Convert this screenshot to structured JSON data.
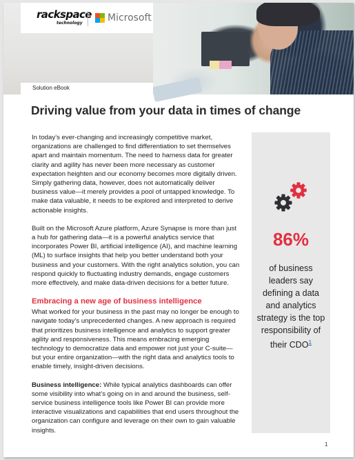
{
  "header": {
    "logo_primary": "rackspace",
    "logo_primary_sub": "technology",
    "logo_partner": "Microsoft",
    "microsoft_colors": [
      "#f25022",
      "#7fba00",
      "#00a4ef",
      "#ffb900"
    ],
    "doc_type": "Solution eBook"
  },
  "title": "Driving value from your data in times of change",
  "body": {
    "paragraphs": [
      "In today’s ever-changing and increasingly competitive market, organizations are challenged to find differentiation to set themselves apart and maintain momentum. The need to harness data for greater clarity and agility has never been more necessary as customer expectation heighten and our economy becomes more digitally driven. Simply gathering data, however, does not automatically deliver business value—it merely provides a pool of untapped knowledge. To make data valuable, it needs to be explored and interpreted to derive actionable insights.",
      "Built on the Microsoft Azure platform, Azure Synapse is more than just a hub for gathering data—it is a powerful analytics service that incorporates Power BI, artificial intelligence (AI), and machine learning (ML) to surface insights that help you better understand both your business and your customers. With the right analytics solution, you can respond quickly to fluctuating industry demands, engage customers more effectively, and make data-driven decisions for a better future."
    ],
    "section_heading": "Embracing a new age of business intelligence",
    "section_paragraph": "What worked for your business in the past may no longer be enough to navigate today’s unprecedented changes. A new approach is required that prioritizes business intelligence and analytics to support greater agility and responsiveness. This means embracing emerging technology to democratize data and empower not just your C-suite—but your entire organization—with the right data and analytics tools to enable timely, insight-driven decisions.",
    "bi_lead": "Business intelligence:",
    "bi_text": " While typical analytics dashboards can offer some visibility into what’s going on in and around the business, self-service business intelligence tools like Power BI can provide more interactive visualizations and capabilities that end users throughout the organization can configure and leverage on their own to gain valuable insights."
  },
  "sidebar": {
    "icon": "gears-icon",
    "stat_value": "86%",
    "stat_text": "of business leaders say defining a data and analytics strategy is the top responsibility of their CDO",
    "footnote_ref": "1",
    "accent_color": "#e03040"
  },
  "page_number": "1"
}
